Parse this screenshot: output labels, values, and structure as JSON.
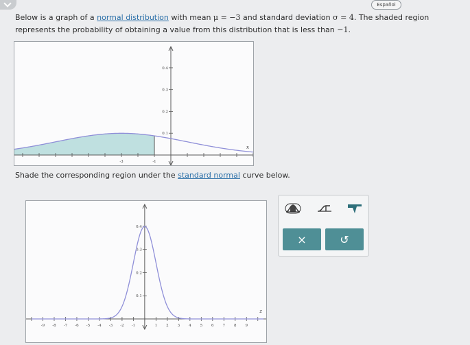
{
  "header": {
    "language_button": "Español"
  },
  "prompt": {
    "part1": "Below is a graph of a ",
    "link": "normal distribution",
    "part2": " with mean ",
    "mu_expr": "μ = −3",
    "part3": " and standard deviation ",
    "sigma_expr": "σ = 4",
    "part4": ". The shaded region represents the probability of obtaining a value from this distribution that is less than ",
    "bound": "−1",
    "part5": "."
  },
  "shade_instruction": {
    "part1": "Shade the corresponding region under the ",
    "link": "standard normal",
    "part2": " curve below."
  },
  "toolbox": {
    "close_symbol": "×",
    "reset_symbol": "↺"
  },
  "chart_data": [
    {
      "type": "area",
      "curve": "normal_pdf",
      "mean": -3,
      "sd": 4,
      "shaded_below": -1,
      "xlim": [
        -9.5,
        5
      ],
      "ylim": [
        0,
        0.45
      ],
      "y_ticks": [
        "0.4",
        "0.3",
        "0.2",
        "0.1"
      ],
      "x_tick_labels": [
        "-3",
        "-1"
      ],
      "x_axis_label": "x",
      "shade_color": "#bfe0e0",
      "curve_color": "#8f8fd8"
    },
    {
      "type": "line",
      "curve": "normal_pdf",
      "mean": 0,
      "sd": 1,
      "xlim": [
        -10,
        10.5
      ],
      "ylim": [
        0,
        0.45
      ],
      "y_ticks": [
        "0.4",
        "0.3",
        "0.2",
        "0.1"
      ],
      "x_tick_labels": [
        "-9",
        "-8",
        "-7",
        "-6",
        "-5",
        "-4",
        "-3",
        "-2",
        "-1",
        "1",
        "2",
        "3",
        "4",
        "5",
        "6",
        "7",
        "8",
        "9"
      ],
      "x_axis_label": "z",
      "curve_color": "#8f8fd8"
    }
  ]
}
